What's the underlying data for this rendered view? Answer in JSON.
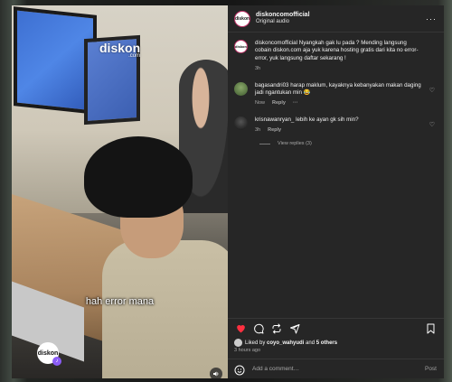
{
  "post": {
    "username": "diskoncomofficial",
    "audio": "Original audio",
    "avatar_text": "diskon"
  },
  "video": {
    "watermark": "diskon",
    "watermark_sub": ".com",
    "caption": "hah error mana",
    "logo_text": "diskon"
  },
  "comments": [
    {
      "username": "diskoncomofficial",
      "text": "Nyangkah gak lu pada ? Mending langsung cobain diskon.com aja yuk karena hosting gratis dari kita no error-error, yuk langsung daftar sekarang ! ",
      "time": "3h",
      "reply": "",
      "extra": ""
    },
    {
      "username": "bagasandri03",
      "text": "harap maklum, kayaknya kebanyakan makan daging jadi ngantukan min 😂",
      "time": "Now",
      "reply": "Reply",
      "extra": "···"
    },
    {
      "username": "krisnawanryan_",
      "text": "lebih ke ayan gk sih min?",
      "time": "3h",
      "reply": "Reply",
      "extra": ""
    }
  ],
  "view_replies": "View replies (3)",
  "likes": {
    "prefix": "Liked by",
    "user": "coyo_wahyudi",
    "connector": "and",
    "others": "5 others"
  },
  "time_ago": "3 hours ago",
  "add_comment": {
    "placeholder": "Add a comment…",
    "post_label": "Post"
  },
  "colors": {
    "panel_bg": "#262626",
    "heart": "#ff3040",
    "muted": "#a8a8a8"
  },
  "icons": {
    "like": "heart-icon",
    "comment": "comment-icon",
    "share": "share-icon",
    "repost": "repost-icon",
    "save": "bookmark-icon",
    "emoji": "emoji-icon",
    "mute": "speaker-icon",
    "more": "more-horizontal-icon"
  }
}
